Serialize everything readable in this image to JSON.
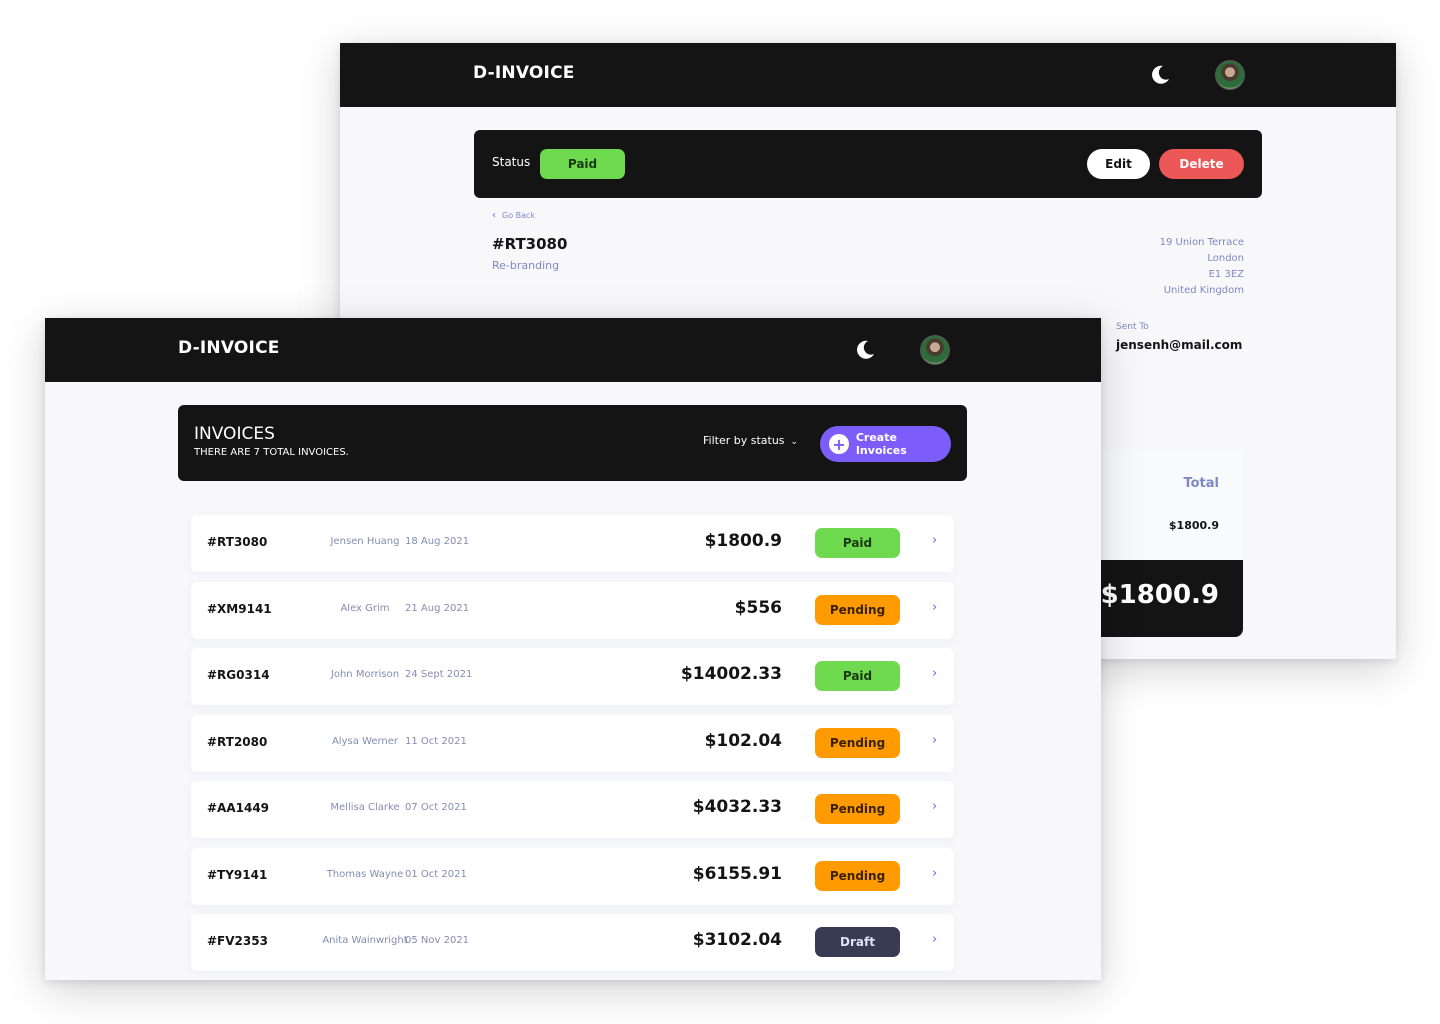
{
  "detail_window": {
    "logo": "D-INVOICE",
    "status_label": "Status",
    "status": "Paid",
    "edit_label": "Edit",
    "delete_label": "Delete",
    "go_back": "Go Back",
    "invoice_id": "#RT3080",
    "description": "Re-branding",
    "address": {
      "street": "19 Union Terrace",
      "city": "London",
      "postcode": "E1 3EZ",
      "country": "United Kingdom"
    },
    "sent_to_label": "Sent To",
    "sent_to_email": "jensenh@mail.com",
    "total_label": "Total",
    "item_total": "$1800.9",
    "amount_due": "$1800.9"
  },
  "list_window": {
    "logo": "D-INVOICE",
    "title": "INVOICES",
    "subtitle": "THERE ARE 7 TOTAL INVOICES.",
    "filter_label": "Filter by status",
    "create_label": "Create Invoices",
    "status_colors": {
      "Paid": "#6fd94f",
      "Pending": "#ff9b00",
      "Draft": "#373b53"
    },
    "invoices": [
      {
        "id": "#RT3080",
        "client": "Jensen Huang",
        "date": "18 Aug 2021",
        "amount": "$1800.9",
        "status": "Paid"
      },
      {
        "id": "#XM9141",
        "client": "Alex Grim",
        "date": "21 Aug 2021",
        "amount": "$556",
        "status": "Pending"
      },
      {
        "id": "#RG0314",
        "client": "John Morrison",
        "date": "24 Sept 2021",
        "amount": "$14002.33",
        "status": "Paid"
      },
      {
        "id": "#RT2080",
        "client": "Alysa Werner",
        "date": "11 Oct 2021",
        "amount": "$102.04",
        "status": "Pending"
      },
      {
        "id": "#AA1449",
        "client": "Mellisa Clarke",
        "date": "07 Oct 2021",
        "amount": "$4032.33",
        "status": "Pending"
      },
      {
        "id": "#TY9141",
        "client": "Thomas Wayne",
        "date": "01 Oct 2021",
        "amount": "$6155.91",
        "status": "Pending"
      },
      {
        "id": "#FV2353",
        "client": "Anita Wainwright",
        "date": "05 Nov 2021",
        "amount": "$3102.04",
        "status": "Draft"
      }
    ]
  },
  "icons": {
    "theme_toggle": "moon-icon",
    "profile": "avatar",
    "back": "chevron-left-icon",
    "filter_dropdown": "chevron-down-icon",
    "create": "plus-icon",
    "row_open": "chevron-right-icon"
  }
}
